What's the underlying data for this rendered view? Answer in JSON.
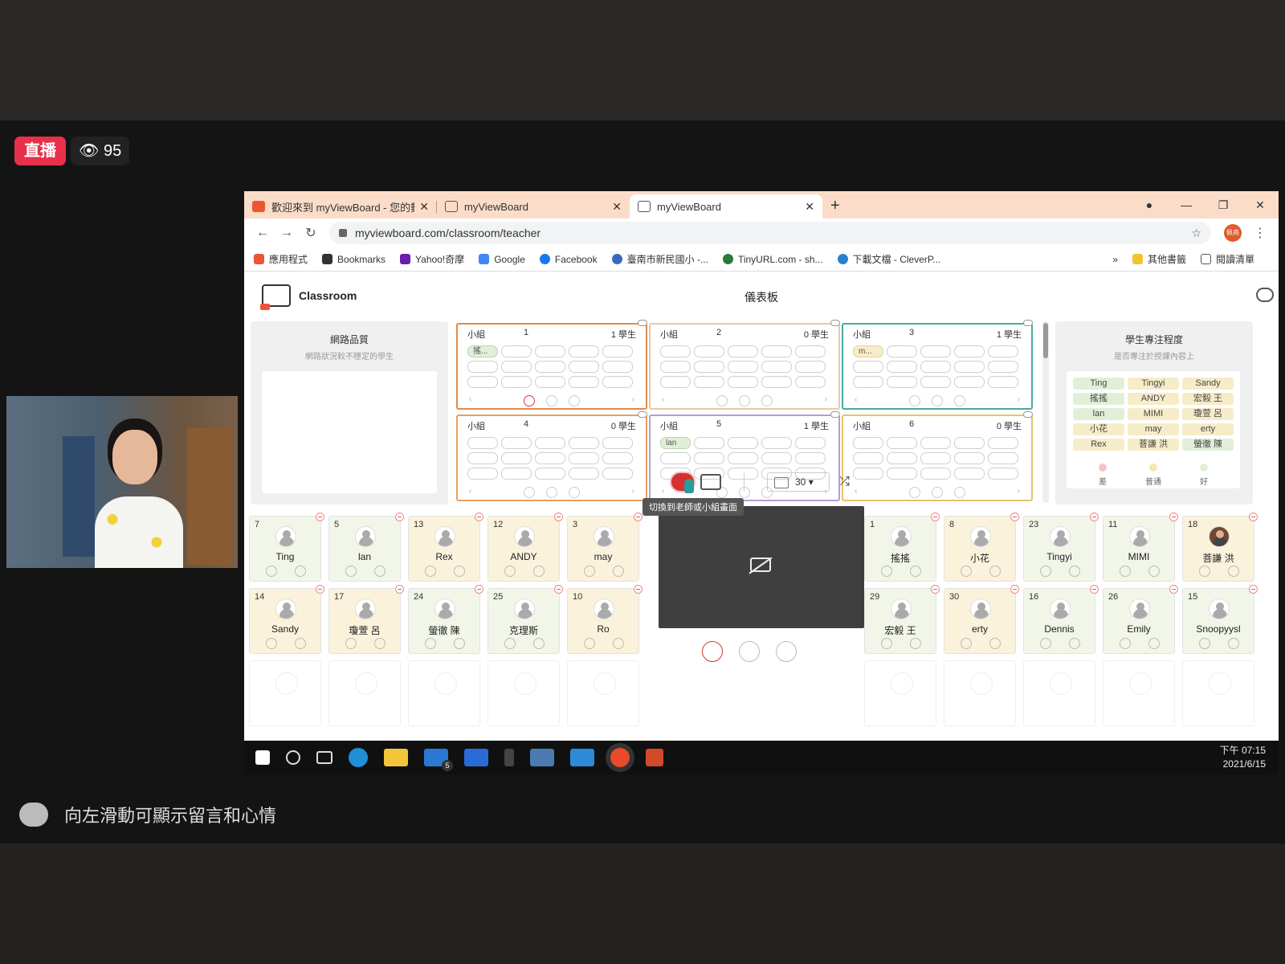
{
  "stream": {
    "live_label": "直播",
    "viewer_count": "95",
    "comment_hint": "向左滑動可顯示留言和心情"
  },
  "browser": {
    "tabs": [
      {
        "title": "歡迎來到 myViewBoard - 您的數",
        "active": false
      },
      {
        "title": "myViewBoard",
        "active": false
      },
      {
        "title": "myViewBoard",
        "active": true
      }
    ],
    "url": "myviewboard.com/classroom/teacher",
    "profile_label": "佩亮",
    "bookmarks": [
      "應用程式",
      "Bookmarks",
      "Yahoo!奇摩",
      "Google",
      "Facebook",
      "臺南市新民國小 -...",
      "TinyURL.com - sh...",
      "下載文檔 - CleverP..."
    ],
    "bookmarks_more": "»",
    "other_bookmarks": "其他書籤",
    "reading_list": "閱讀清單"
  },
  "app": {
    "title": "Classroom",
    "dashboard_label": "儀表板",
    "network": {
      "title": "網路品質",
      "subtitle": "網路狀況較不穩定的學生"
    },
    "focus": {
      "title": "學生專注程度",
      "subtitle": "是否專注於授課內容上",
      "names": [
        "Ting",
        "Tingyi",
        "Sandy",
        "搖搖",
        "ANDY",
        "宏毅 王",
        "lan",
        "MIMI",
        "瓊萱 呂",
        "小花",
        "may",
        "erty",
        "Rex",
        "菩謙 洪",
        "螢徹 陳"
      ],
      "legend": [
        "差",
        "普通",
        "好"
      ]
    },
    "groups": [
      {
        "label": "小組",
        "num": "1",
        "count": "1 學生",
        "members": [
          "搖..."
        ]
      },
      {
        "label": "小組",
        "num": "2",
        "count": "0 學生",
        "members": []
      },
      {
        "label": "小組",
        "num": "3",
        "count": "1 學生",
        "members": [
          "m..."
        ]
      },
      {
        "label": "小組",
        "num": "4",
        "count": "0 學生",
        "members": []
      },
      {
        "label": "小組",
        "num": "5",
        "count": "1 學生",
        "members": [
          "lan"
        ]
      },
      {
        "label": "小組",
        "num": "6",
        "count": "0 學生",
        "members": []
      }
    ],
    "students_left": [
      {
        "num": "7",
        "name": "Ting"
      },
      {
        "num": "5",
        "name": "lan"
      },
      {
        "num": "13",
        "name": "Rex"
      },
      {
        "num": "12",
        "name": "ANDY"
      },
      {
        "num": "3",
        "name": "may"
      },
      {
        "num": "14",
        "name": "Sandy"
      },
      {
        "num": "17",
        "name": "瓊萱 呂"
      },
      {
        "num": "24",
        "name": "螢徹 陳"
      },
      {
        "num": "25",
        "name": "克理斯"
      },
      {
        "num": "10",
        "name": "Ro"
      }
    ],
    "students_right": [
      {
        "num": "1",
        "name": "搖搖"
      },
      {
        "num": "8",
        "name": "小花"
      },
      {
        "num": "23",
        "name": "Tingyi"
      },
      {
        "num": "11",
        "name": "MIMI"
      },
      {
        "num": "18",
        "name": "菩謙 洪"
      },
      {
        "num": "29",
        "name": "宏毅 王"
      },
      {
        "num": "30",
        "name": "erty"
      },
      {
        "num": "16",
        "name": "Dennis"
      },
      {
        "num": "26",
        "name": "Emily"
      },
      {
        "num": "15",
        "name": "Snoopyysl"
      }
    ],
    "timer_value": "30",
    "tooltip": "切換到老師或小組畫面"
  },
  "taskbar": {
    "clock_time": "下午 07:15",
    "clock_date": "2021/6/15",
    "mail_badge": "5"
  },
  "colors": {
    "live": "#e8304a",
    "tab_bar": "#fbdcc8",
    "group1": "#e08a4a",
    "group2": "#e8c8a8",
    "group3": "#4aa8a0",
    "group4": "#e8a060",
    "group5": "#b89cd0",
    "group6": "#e8c070",
    "card_green": "#f1f6e8",
    "card_yellow": "#fbf2dc"
  }
}
